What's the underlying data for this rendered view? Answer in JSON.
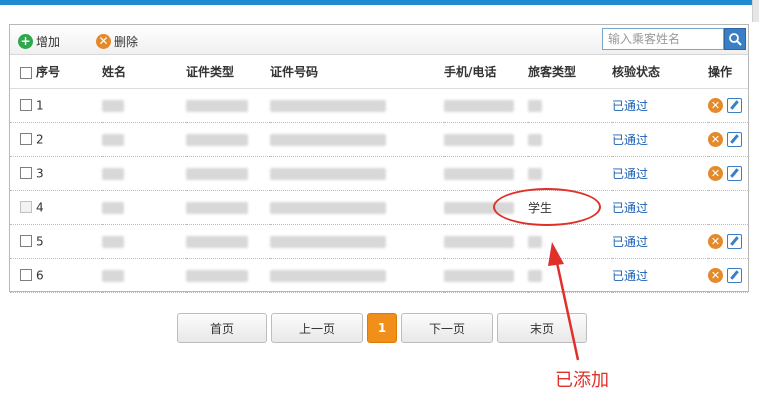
{
  "toolbar": {
    "add_label": "增加",
    "delete_label": "删除",
    "search_placeholder": "输入乘客姓名"
  },
  "table": {
    "headers": {
      "seq": "序号",
      "name": "姓名",
      "id_type": "证件类型",
      "id_no": "证件号码",
      "phone": "手机/电话",
      "passenger_type": "旅客类型",
      "verify_status": "核验状态",
      "ops": "操作"
    },
    "rows": [
      {
        "no": "1",
        "passenger_type": "",
        "status": "已通过"
      },
      {
        "no": "2",
        "passenger_type": "",
        "status": "已通过"
      },
      {
        "no": "3",
        "passenger_type": "",
        "status": "已通过"
      },
      {
        "no": "4",
        "passenger_type": "学生",
        "status": "已通过"
      },
      {
        "no": "5",
        "passenger_type": "",
        "status": "已通过"
      },
      {
        "no": "6",
        "passenger_type": "",
        "status": "已通过"
      }
    ]
  },
  "pagination": {
    "first": "首页",
    "prev": "上一页",
    "current": "1",
    "next": "下一页",
    "last": "末页"
  },
  "annotation": {
    "text": "已添加",
    "color": "#e0302a"
  },
  "colors": {
    "accent": "#1e8bd2",
    "status_link": "#1a5fb4",
    "current_page": "#f0901a",
    "delete_icon": "#e28a2c"
  }
}
